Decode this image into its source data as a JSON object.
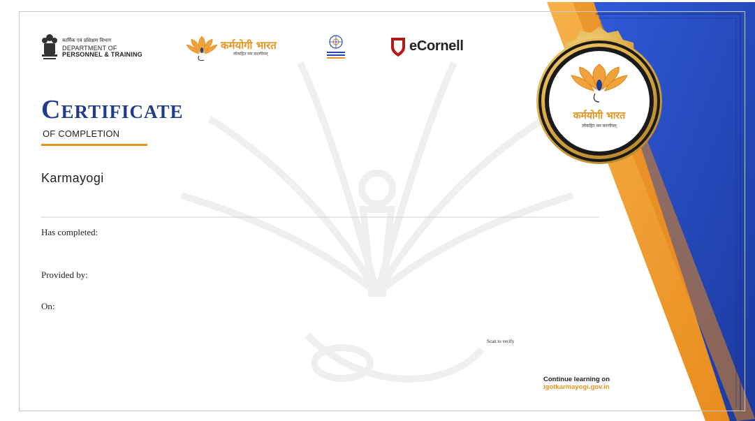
{
  "header": {
    "dopt": {
      "line1": "कार्मिक एवं प्रशिक्षण विभाग",
      "line2": "DEPARTMENT OF",
      "line3": "PERSONNEL & TRAINING"
    },
    "karmayogi_logo": {
      "hindi": "कर्मयोगी भारत",
      "tagline": "लोकहित मम करणीयम्"
    },
    "capacity_logo_name": "capacity-building-commission-logo",
    "ecornell": "eCornell"
  },
  "certificate": {
    "title": "Certificate",
    "subtitle": "OF COMPLETION",
    "recipient": "Karmayogi"
  },
  "fields": {
    "has_completed": "Has completed:",
    "provided_by": "Provided by:",
    "on": "On:"
  },
  "verify": {
    "scan_text": "Scan to verify"
  },
  "footer": {
    "continue_text": "Continue learning on",
    "url": "igotkarmayogi.gov.in"
  },
  "seal": {
    "hindi": "कर्मयोगी भारत",
    "tagline": "लोकहित मम करणीयम्"
  },
  "colors": {
    "title_blue": "#1f3b8c",
    "accent_orange": "#e8931e",
    "side_blue": "#2547b8",
    "gold": "#e3b54a"
  }
}
